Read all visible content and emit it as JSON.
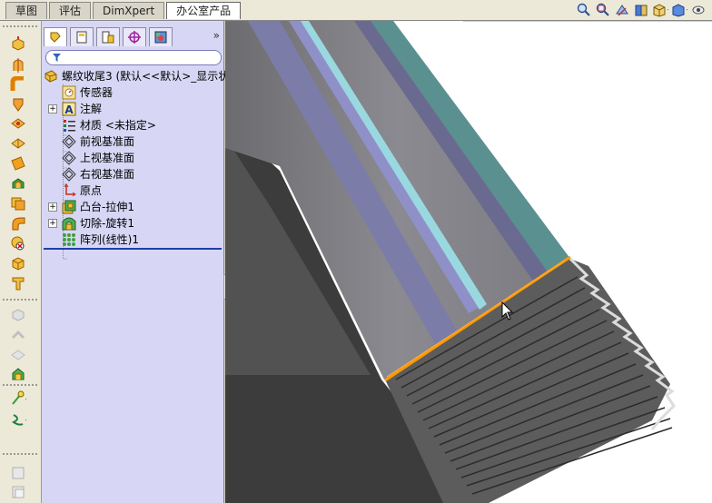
{
  "tabs": [
    "草图",
    "评估",
    "DimXpert",
    "办公室产品"
  ],
  "active_tab": "办公室产品",
  "view_tools": [
    "zoom-to-fit-icon",
    "zoom-area-icon",
    "previous-view-icon",
    "section-view-icon",
    "view-orientation-icon",
    "display-style-icon",
    "hide-show-icon"
  ],
  "command_icons": [
    "extruded-boss-icon",
    "revolved-boss-icon",
    "swept-boss-icon",
    "extruded-cut-icon",
    "revolved-cut-icon",
    "plane-icon",
    "fillet-icon",
    "shell-icon",
    "rib-icon",
    "hole-wizard-icon",
    "dome-icon",
    "draft-icon",
    "disabled-feature-icon",
    "disabled-feature-icon",
    "disabled-feature-icon",
    "intersect-icon",
    "reference-geometry-icon",
    "curves-icon",
    "instant3d-icon",
    "instant3d-icon"
  ],
  "panel": {
    "tabs": [
      "feature-manager-icon",
      "property-manager-icon",
      "configuration-manager-icon",
      "dimxpert-manager-icon",
      "display-manager-icon"
    ],
    "more": "»"
  },
  "tree": {
    "root": "螺纹收尾3  (默认<<默认>_显示状",
    "items": [
      {
        "label": "传感器",
        "icon": "sensor-icon",
        "expandable": false
      },
      {
        "label": "注解",
        "icon": "annotations-icon",
        "expandable": true
      },
      {
        "label": "材质 <未指定>",
        "icon": "material-icon",
        "expandable": false
      },
      {
        "label": "前视基准面",
        "icon": "plane-icon",
        "expandable": false
      },
      {
        "label": "上视基准面",
        "icon": "plane-icon",
        "expandable": false
      },
      {
        "label": "右视基准面",
        "icon": "plane-icon",
        "expandable": false
      },
      {
        "label": "原点",
        "icon": "origin-icon",
        "expandable": false
      },
      {
        "label": "凸台-拉伸1",
        "icon": "boss-extrude-icon",
        "expandable": true
      },
      {
        "label": "切除-旋转1",
        "icon": "cut-revolve-icon",
        "expandable": true
      },
      {
        "label": "阵列(线性)1",
        "icon": "linear-pattern-icon",
        "expandable": false
      }
    ]
  },
  "colors": {
    "selection": "#ff9900",
    "panel": "#d7d7f5",
    "tree_line": "#1f3fa8"
  }
}
